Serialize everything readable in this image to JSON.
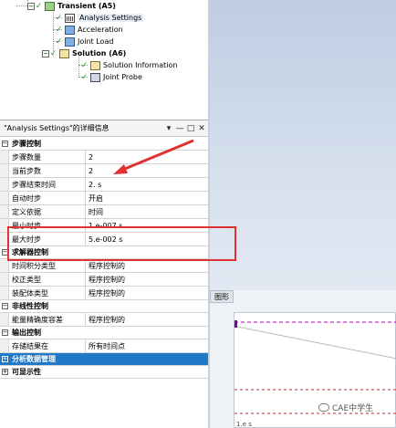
{
  "tree": {
    "nodes": [
      {
        "label": "Transient (A5)",
        "bold": true
      },
      {
        "label": "Analysis Settings",
        "selected": true
      },
      {
        "label": "Acceleration"
      },
      {
        "label": "Joint Load"
      },
      {
        "label": "Solution (A6)",
        "bold": true
      },
      {
        "label": "Solution Information"
      },
      {
        "label": "Joint Probe"
      }
    ],
    "check_glyph": "✓"
  },
  "details": {
    "title": "\"Analysis Settings\"的详细信息",
    "title_buttons": [
      "▾",
      "—",
      "□",
      "✕"
    ],
    "categories": [
      {
        "name": "步骤控制",
        "toggle": "−",
        "rows": [
          {
            "name": "步骤数量",
            "value": "2"
          },
          {
            "name": "当前步数",
            "value": "2"
          },
          {
            "name": "步骤结束时间",
            "value": "2. s"
          },
          {
            "name": "自动时步",
            "value": "开启"
          },
          {
            "name": "定义依据",
            "value": "时间"
          },
          {
            "name": "最小时步",
            "value": "1.e-007 s"
          },
          {
            "name": "最大时步",
            "value": "5.e-002 s"
          }
        ]
      },
      {
        "name": "求解器控制",
        "toggle": "−",
        "rows": [
          {
            "name": "时间积分类型",
            "value": "程序控制的"
          },
          {
            "name": "校正类型",
            "value": "程序控制的"
          },
          {
            "name": "装配体类型",
            "value": "程序控制的"
          }
        ]
      },
      {
        "name": "非线性控制",
        "toggle": "−",
        "rows": [
          {
            "name": "能量精确度容差",
            "value": "程序控制的"
          }
        ]
      },
      {
        "name": "输出控制",
        "toggle": "−",
        "rows": [
          {
            "name": "存储结果在",
            "value": "所有时间点"
          }
        ]
      },
      {
        "name": "分析数据管理",
        "toggle": "+",
        "selected": true,
        "rows": []
      },
      {
        "name": "可显示性",
        "toggle": "+",
        "rows": []
      }
    ]
  },
  "graph": {
    "tab_label": "图形",
    "axis_label": "1.e s"
  },
  "watermark": "CAE中学生",
  "colors": {
    "annotation_red": "#e03030",
    "selection_blue": "#1f78c8",
    "check_green": "#2a9a2a",
    "trace_magenta": "#b000b0"
  }
}
